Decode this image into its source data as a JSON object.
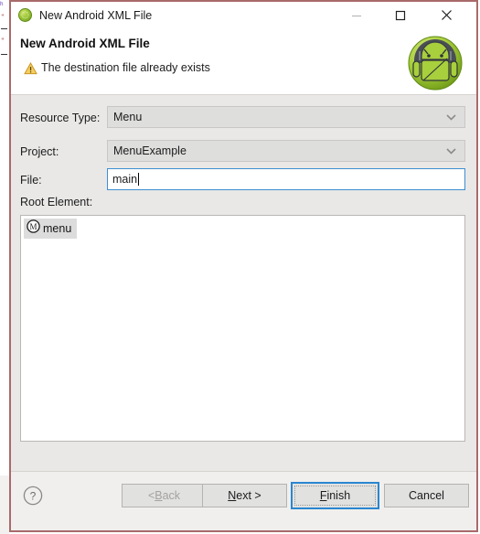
{
  "window": {
    "title": "New Android XML File",
    "title_icon": "android-ball-icon",
    "controls": {
      "minimize": "minimize-icon",
      "maximize": "maximize-icon",
      "close": "close-icon"
    }
  },
  "header": {
    "title": "New Android XML File",
    "message": "The destination file already exists",
    "message_icon": "warning-triangle-icon",
    "logo_icon": "android-robot-head-icon"
  },
  "form": {
    "resource_type": {
      "label": "Resource Type:",
      "value": "Menu",
      "options": [
        "Menu"
      ]
    },
    "project": {
      "label": "Project:",
      "value": "MenuExample",
      "options": [
        "MenuExample"
      ]
    },
    "file": {
      "label": "File:",
      "value": "main",
      "placeholder": ""
    },
    "root_element": {
      "label": "Root Element:",
      "items": [
        {
          "label": "menu",
          "icon": "circled-m-icon",
          "selected": true
        }
      ]
    }
  },
  "footer": {
    "help_icon": "question-mark-icon",
    "buttons": {
      "back": {
        "prefix": "< ",
        "mnemonic": "B",
        "rest": "ack",
        "enabled": false
      },
      "next": {
        "mnemonic": "N",
        "rest": "ext >",
        "enabled": true
      },
      "finish": {
        "mnemonic": "F",
        "rest": "inish",
        "enabled": true,
        "default": true
      },
      "cancel": {
        "label": "Cancel",
        "enabled": true
      }
    }
  },
  "colors": {
    "dialog_border": "#a96a6a",
    "accent_blue": "#2a86d0",
    "body_bg": "#e9e8e7",
    "header_bg": "#ffffff",
    "footer_bg": "#f0efee",
    "warning_yellow": "#f0b323",
    "android_green": "#9dc636"
  }
}
